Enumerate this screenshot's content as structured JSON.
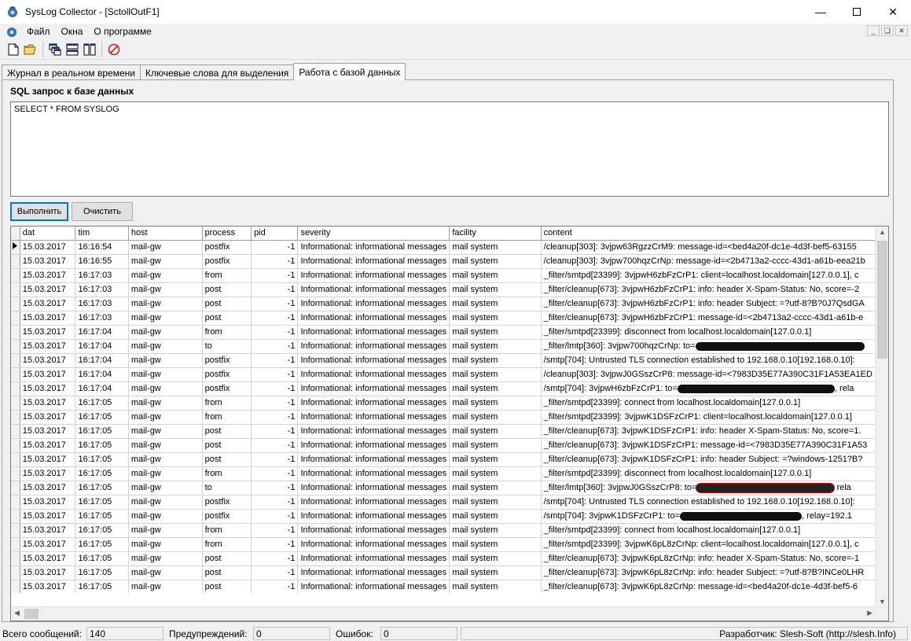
{
  "window": {
    "title": "SysLog Collector - [SctollOutF1]"
  },
  "menu": {
    "items": [
      "Файл",
      "Окна",
      "О программе"
    ]
  },
  "tabs": [
    {
      "label": "Журнал в реальном времени"
    },
    {
      "label": "Ключевые слова для выделения"
    },
    {
      "label": "Работа с базой данных"
    }
  ],
  "query": {
    "label": "SQL запрос к базе данных",
    "text": "SELECT * FROM SYSLOG",
    "run_label": "Выполнить",
    "clear_label": "Очистить"
  },
  "grid": {
    "columns": [
      "dat",
      "tim",
      "host",
      "process",
      "pid",
      "severity",
      "facility",
      "content"
    ],
    "rows": [
      [
        "15.03.2017",
        "16:16:54",
        "mail-gw",
        "postfix",
        "-1",
        "Informational: informational messages",
        "mail system",
        "/cleanup[303]: 3vjpw63RgzzCrM9: message-id=<bed4a20f-dc1e-4d3f-bef5-63155"
      ],
      [
        "15.03.2017",
        "16:16:55",
        "mail-gw",
        "postfix",
        "-1",
        "Informational: informational messages",
        "mail system",
        "/cleanup[303]: 3vjpw700hqzCrNp: message-id=<2b4713a2-cccc-43d1-a61b-eea21b"
      ],
      [
        "15.03.2017",
        "16:17:03",
        "mail-gw",
        "from",
        "-1",
        "Informational: informational messages",
        "mail system",
        "_filter/smtpd[23399]: 3vjpwH6zbFzCrP1: client=localhost.localdomain[127.0.0.1], c"
      ],
      [
        "15.03.2017",
        "16:17:03",
        "mail-gw",
        "post",
        "-1",
        "Informational: informational messages",
        "mail system",
        "_filter/cleanup[673]: 3vjpwH6zbFzCrP1: info: header X-Spam-Status: No, score=-2"
      ],
      [
        "15.03.2017",
        "16:17:03",
        "mail-gw",
        "post",
        "-1",
        "Informational: informational messages",
        "mail system",
        "_filter/cleanup[673]: 3vjpwH6zbFzCrP1: info: header Subject: =?utf-8?B?0J7QsdGA"
      ],
      [
        "15.03.2017",
        "16:17:03",
        "mail-gw",
        "post",
        "-1",
        "Informational: informational messages",
        "mail system",
        "_filter/cleanup[673]: 3vjpwH6zbFzCrP1: message-id=<2b4713a2-cccc-43d1-a61b-e"
      ],
      [
        "15.03.2017",
        "16:17:04",
        "mail-gw",
        "from",
        "-1",
        "Informational: informational messages",
        "mail system",
        "_filter/smtpd[23399]: disconnect from localhost.localdomain[127.0.0.1]"
      ],
      [
        "15.03.2017",
        "16:17:04",
        "mail-gw",
        "to",
        "-1",
        "Informational: informational messages",
        "mail system",
        "_filter/lmtp[360]: 3vjpw700hqzCrNp: to="
      ],
      [
        "15.03.2017",
        "16:17:04",
        "mail-gw",
        "postfix",
        "-1",
        "Informational: informational messages",
        "mail system",
        "/smtp[704]: Untrusted TLS connection established to 192.168.0.10[192.168.0.10]:"
      ],
      [
        "15.03.2017",
        "16:17:04",
        "mail-gw",
        "postfix",
        "-1",
        "Informational: informational messages",
        "mail system",
        "/cleanup[303]: 3vjpwJ0GSszCrP8: message-id=<7983D35E77A390C31F1A53EA1ED"
      ],
      [
        "15.03.2017",
        "16:17:04",
        "mail-gw",
        "postfix",
        "-1",
        "Informational: informational messages",
        "mail system",
        "/smtp[704]: 3vjpwH6zbFzCrP1: to="
      ],
      [
        "15.03.2017",
        "16:17:05",
        "mail-gw",
        "from",
        "-1",
        "Informational: informational messages",
        "mail system",
        "_filter/smtpd[23399]: connect from localhost.localdomain[127.0.0.1]"
      ],
      [
        "15.03.2017",
        "16:17:05",
        "mail-gw",
        "from",
        "-1",
        "Informational: informational messages",
        "mail system",
        "_filter/smtpd[23399]: 3vjpwK1DSFzCrP1: client=localhost.localdomain[127.0.0.1]"
      ],
      [
        "15.03.2017",
        "16:17:05",
        "mail-gw",
        "post",
        "-1",
        "Informational: informational messages",
        "mail system",
        "_filter/cleanup[673]: 3vjpwK1DSFzCrP1: info: header X-Spam-Status: No, score=1."
      ],
      [
        "15.03.2017",
        "16:17:05",
        "mail-gw",
        "post",
        "-1",
        "Informational: informational messages",
        "mail system",
        "_filter/cleanup[673]: 3vjpwK1DSFzCrP1: message-id=<7983D35E77A390C31F1A53"
      ],
      [
        "15.03.2017",
        "16:17:05",
        "mail-gw",
        "post",
        "-1",
        "Informational: informational messages",
        "mail system",
        "_filter/cleanup[673]: 3vjpwK1DSFzCrP1: info: header Subject: =?windows-1251?B?"
      ],
      [
        "15.03.2017",
        "16:17:05",
        "mail-gw",
        "from",
        "-1",
        "Informational: informational messages",
        "mail system",
        "_filter/smtpd[23399]: disconnect from localhost.localdomain[127.0.0.1]"
      ],
      [
        "15.03.2017",
        "16:17:05",
        "mail-gw",
        "to",
        "-1",
        "Informational: informational messages",
        "mail system",
        "_filter/lmtp[360]: 3vjpwJ0GSszCrP8: to="
      ],
      [
        "15.03.2017",
        "16:17:05",
        "mail-gw",
        "postfix",
        "-1",
        "Informational: informational messages",
        "mail system",
        "/smtp[704]: Untrusted TLS connection established to 192.168.0.10[192.168.0.10]:"
      ],
      [
        "15.03.2017",
        "16:17:05",
        "mail-gw",
        "postfix",
        "-1",
        "Informational: informational messages",
        "mail system",
        "/smtp[704]: 3vjpwK1DSFzCrP1: to="
      ],
      [
        "15.03.2017",
        "16:17:05",
        "mail-gw",
        "from",
        "-1",
        "Informational: informational messages",
        "mail system",
        "_filter/smtpd[23399]: connect from localhost.localdomain[127.0.0.1]"
      ],
      [
        "15.03.2017",
        "16:17:05",
        "mail-gw",
        "from",
        "-1",
        "Informational: informational messages",
        "mail system",
        "_filter/smtpd[23399]: 3vjpwK6pL8zCrNp: client=localhost.localdomain[127.0.0.1], c"
      ],
      [
        "15.03.2017",
        "16:17:05",
        "mail-gw",
        "post",
        "-1",
        "Informational: informational messages",
        "mail system",
        "_filter/cleanup[673]: 3vjpwK6pL8zCrNp: info: header X-Spam-Status: No, score=-1"
      ],
      [
        "15.03.2017",
        "16:17:05",
        "mail-gw",
        "post",
        "-1",
        "Informational: informational messages",
        "mail system",
        "_filter/cleanup[673]: 3vjpwK6pL8zCrNp: info: header Subject: =?utf-8?B?INCe0LHR"
      ],
      [
        "15.03.2017",
        "16:17:05",
        "mail-gw",
        "post",
        "-1",
        "Informational: informational messages",
        "mail system",
        "_filter/cleanup[673]: 3vjpwK6pL8zCrNp: message-id=<bed4a20f-dc1e-4d3f-bef5-6"
      ]
    ],
    "tails": {
      "7": "",
      "10": ", rela",
      "17": " rela",
      "19": ", relay=192.1"
    }
  },
  "status": {
    "total_label": "Всего сообщений:",
    "total_value": "140",
    "warn_label": "Предупреждений:",
    "warn_value": "0",
    "err_label": "Ошибок:",
    "err_value": "0",
    "developer": "Разработчик: Slesh-Soft (http://slesh.Info)"
  }
}
